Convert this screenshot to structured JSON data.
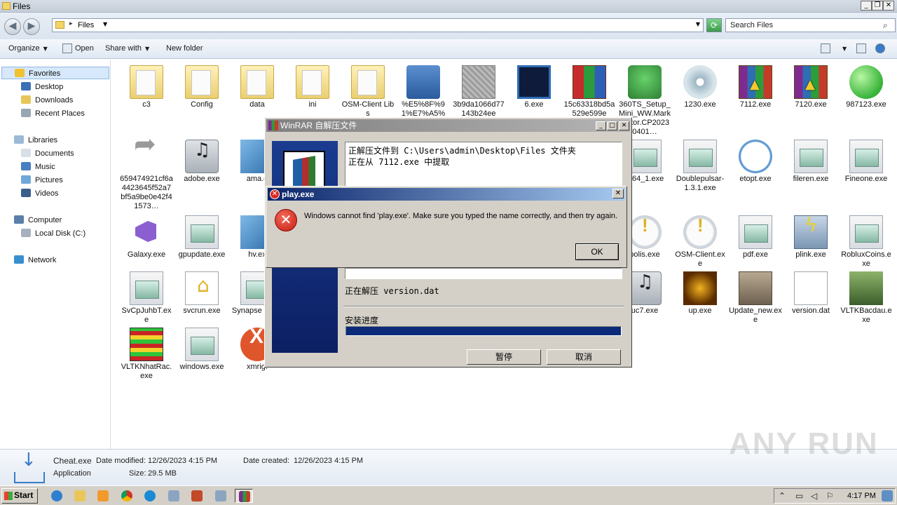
{
  "window": {
    "title": "Files"
  },
  "address": {
    "crumb": "Files",
    "search_placeholder": "Search Files"
  },
  "toolbar": {
    "organize": "Organize",
    "open": "Open",
    "share_with": "Share with",
    "new_folder": "New folder"
  },
  "sidebar": {
    "favorites": "Favorites",
    "fav_items": [
      "Desktop",
      "Downloads",
      "Recent Places"
    ],
    "libraries": "Libraries",
    "lib_items": [
      "Documents",
      "Music",
      "Pictures",
      "Videos"
    ],
    "computer": "Computer",
    "comp_items": [
      "Local Disk (C:)"
    ],
    "network": "Network"
  },
  "files": [
    {
      "name": "c3",
      "icon": "folder-icon"
    },
    {
      "name": "Config",
      "icon": "folder-icon"
    },
    {
      "name": "data",
      "icon": "folder-icon"
    },
    {
      "name": "ini",
      "icon": "folder-icon"
    },
    {
      "name": "OSM-Client Libs",
      "icon": "folder-icon"
    },
    {
      "name": "%E5%8F%91%E7%A5%",
      "icon": "shield-icon"
    },
    {
      "name": "3b9da1066d77143b24ee",
      "icon": "gray-exe-icon"
    },
    {
      "name": "6.exe",
      "icon": "terminal-icon"
    },
    {
      "name": "15c63318bd5a529e599e",
      "icon": "books-icon"
    },
    {
      "name": "360TS_Setup_Mini_WW.Marketator.CP20230401…",
      "icon": "setup-icon"
    },
    {
      "name": "1230.exe",
      "icon": "disc-icon"
    },
    {
      "name": "7112.exe",
      "icon": "winrar-icon"
    },
    {
      "name": "7120.exe",
      "icon": "winrar-icon"
    },
    {
      "name": "987123.exe",
      "icon": "green-ball-icon"
    },
    {
      "name": "659474921cf6a4423645f52a7bf5a9be0e42f41573…",
      "icon": "arrow-icon"
    },
    {
      "name": "adobe.exe",
      "icon": "music-icon"
    },
    {
      "name": "ama.e",
      "icon": "monitor-icon"
    },
    {
      "name": "ta64_1.exe",
      "icon": "exe-icon"
    },
    {
      "name": "Doublepulsar-1.3.1.exe",
      "icon": "exe-icon"
    },
    {
      "name": "etopt.exe",
      "icon": "clock-icon"
    },
    {
      "name": "fileren.exe",
      "icon": "exe-icon"
    },
    {
      "name": "Fineone.exe",
      "icon": "exe-icon"
    },
    {
      "name": "Galaxy.exe",
      "icon": "vs-icon"
    },
    {
      "name": "gpupdate.exe",
      "icon": "exe-icon"
    },
    {
      "name": "hv.ex",
      "icon": "cube-icon"
    },
    {
      "name": "polis.exe",
      "icon": "info-icon"
    },
    {
      "name": "OSM-Client.exe",
      "icon": "info-icon"
    },
    {
      "name": "pdf.exe",
      "icon": "exe-icon"
    },
    {
      "name": "plink.exe",
      "icon": "plink-icon"
    },
    {
      "name": "RobluxCoins.exe",
      "icon": "exe-icon"
    },
    {
      "name": "SvCpJuhbT.exe",
      "icon": "exe-icon"
    },
    {
      "name": "svcrun.exe",
      "icon": "house-icon"
    },
    {
      "name": "Synapse oit.ex",
      "icon": "exe-icon"
    },
    {
      "name": "uc7.exe",
      "icon": "music-icon"
    },
    {
      "name": "up.exe",
      "icon": "mc-icon"
    },
    {
      "name": "Update_new.exe",
      "icon": "box-icon"
    },
    {
      "name": "version.dat",
      "icon": "doc-icon"
    },
    {
      "name": "VLTKBacdau.exe",
      "icon": "knight-icon"
    },
    {
      "name": "VLTKNhatRac.exe",
      "icon": "vltk-icon"
    },
    {
      "name": "windows.exe",
      "icon": "exe-icon"
    },
    {
      "name": "xmrig.",
      "icon": "xmrig-icon"
    }
  ],
  "details": {
    "name": "Cheat.exe",
    "type": "Application",
    "modified_label": "Date modified:",
    "modified_value": "12/26/2023 4:15 PM",
    "size_label": "Size:",
    "size_value": "29.5 MB",
    "created_label": "Date created:",
    "created_value": "12/26/2023 4:15 PM"
  },
  "watermark": "ANY RUN",
  "winrar": {
    "title": "WinRAR 自解压文件",
    "line1": "正解压文件到 C:\\Users\\admin\\Desktop\\Files 文件夹",
    "line2": "正在从 7112.exe 中提取",
    "current": "正在解压 version.dat",
    "progress_label": "安装进度",
    "progress": 1.0,
    "pause": "暂停",
    "cancel": "取消"
  },
  "error": {
    "title": "play.exe",
    "message": "Windows cannot find 'play.exe'. Make sure you typed the name correctly, and then try again.",
    "ok": "OK"
  },
  "taskbar": {
    "start": "Start",
    "time": "4:17 PM"
  }
}
